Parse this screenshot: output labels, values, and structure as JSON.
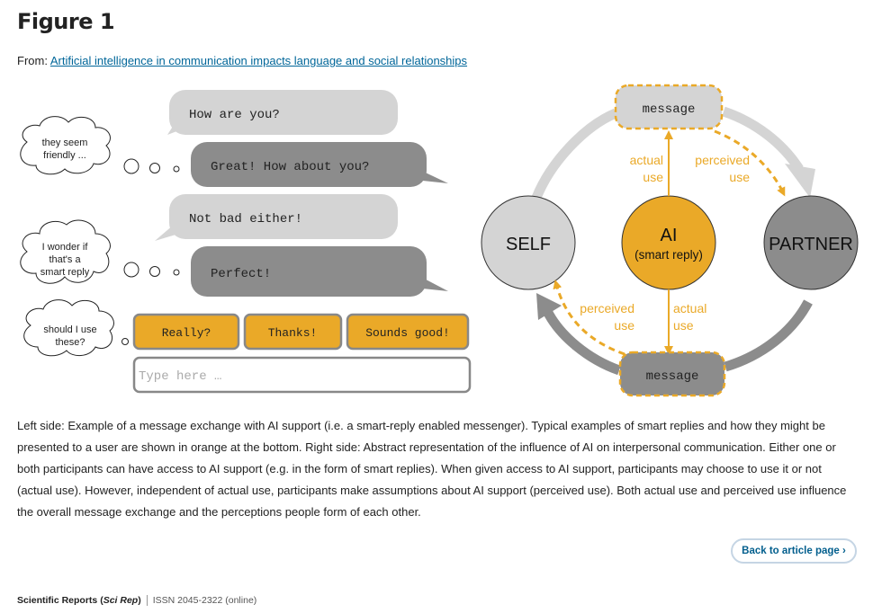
{
  "header": {
    "title": "Figure 1",
    "from_prefix": "From: ",
    "from_link": "Artificial intelligence in communication impacts language and social relationships"
  },
  "figure": {
    "left": {
      "thoughts": [
        {
          "lines": [
            "they seem",
            "friendly ..."
          ]
        },
        {
          "lines": [
            "I wonder if",
            "that's a",
            "smart reply"
          ]
        },
        {
          "lines": [
            "should I use",
            "these?"
          ]
        }
      ],
      "messages": [
        {
          "text": "How are you?",
          "sender": "partner"
        },
        {
          "text": "Great! How about you?",
          "sender": "self"
        },
        {
          "text": "Not bad either!",
          "sender": "partner"
        },
        {
          "text": "Perfect!",
          "sender": "self"
        }
      ],
      "smart_replies": [
        "Really?",
        "Thanks!",
        "Sounds good!"
      ],
      "input_placeholder": "Type here …"
    },
    "right": {
      "self_label": "SELF",
      "partner_label": "PARTNER",
      "ai_label": "AI",
      "ai_sublabel": "(smart reply)",
      "message_top": "message",
      "message_bottom": "message",
      "actual_use_top": [
        "actual",
        "use"
      ],
      "perceived_use_top": [
        "perceived",
        "use"
      ],
      "actual_use_bottom": [
        "actual",
        "use"
      ],
      "perceived_use_bottom": [
        "perceived",
        "use"
      ]
    },
    "colors": {
      "orange": "#eaa928",
      "light_gray": "#d4d4d4",
      "dark_gray": "#8c8c8c",
      "link": "#006699"
    }
  },
  "caption": "Left side: Example of a message exchange with AI support (i.e. a smart-reply enabled messenger). Typical examples of smart replies and how they might be presented to a user are shown in orange at the bottom. Right side: Abstract representation of the influence of AI on interpersonal communication. Either one or both participants can have access to AI support (e.g. in the form of smart replies). When given access to AI support, participants may choose to use it or not (actual use). However, independent of actual use, participants make assumptions about AI support (perceived use). Both actual use and perceived use influence the overall message exchange and the perceptions people form of each other.",
  "back_button": "Back to article page ›",
  "footer": {
    "journal": "Scientific Reports (",
    "journal_abbr": "Sci Rep",
    "journal_close": ")",
    "issn": "ISSN 2045-2322 (online)"
  }
}
